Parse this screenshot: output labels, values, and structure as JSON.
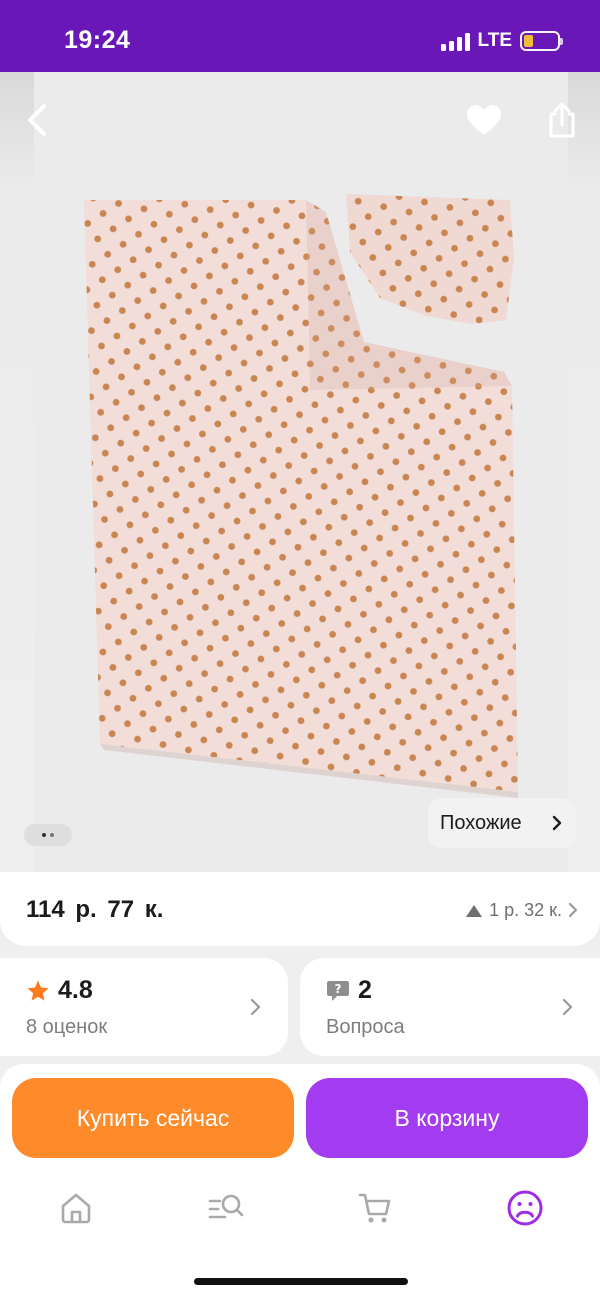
{
  "status_bar": {
    "time": "19:24",
    "network": "LTE",
    "battery_color": "#f7c62f"
  },
  "product": {
    "image_alt": "Light pink bedding set with brown polka dots",
    "image_dots": "2 pages, first active",
    "similar_label": "Похожие",
    "price": "114 р.  77 к.",
    "price_change": "1 р.  32 к."
  },
  "rating": {
    "value": "4.8",
    "label": "8 оценок"
  },
  "questions": {
    "value": "2",
    "label": "Вопроса"
  },
  "actions": {
    "buy_now": "Купить сейчас",
    "add_to_cart": "В корзину"
  },
  "tab_bar": {
    "items": [
      {
        "icon": "home-icon",
        "active": false
      },
      {
        "icon": "catalog-search-icon",
        "active": false
      },
      {
        "icon": "cart-icon",
        "active": false
      },
      {
        "icon": "profile-icon",
        "active": true
      }
    ]
  },
  "colors": {
    "brand_purple": "#6a17b8",
    "buy_orange": "#ff8a2a",
    "cart_purple": "#a33cf0",
    "rating_star": "#ff7a1a"
  }
}
